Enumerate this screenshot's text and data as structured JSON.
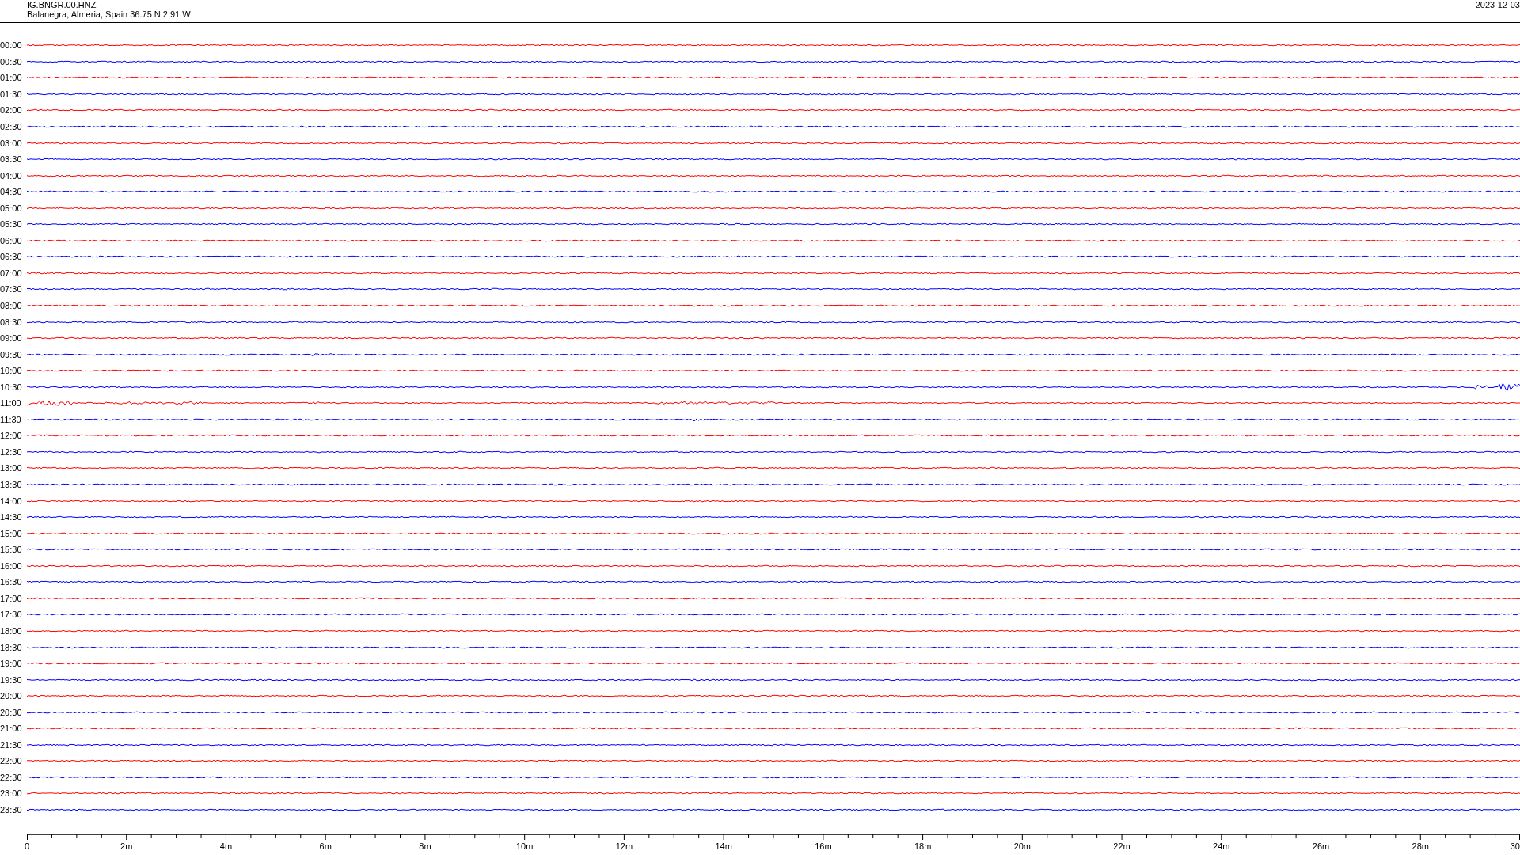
{
  "header": {
    "station": "IG.BNGR.00.HNZ",
    "location": "Balanegra, Almeria, Spain  36.75 N 2.91 W",
    "date": "2023-12-03"
  },
  "rows": [
    {
      "time": "00:00",
      "color": "#ff0000"
    },
    {
      "time": "00:30",
      "color": "#0000ff"
    },
    {
      "time": "01:00",
      "color": "#ff0000"
    },
    {
      "time": "01:30",
      "color": "#0000ff"
    },
    {
      "time": "02:00",
      "color": "#ff0000"
    },
    {
      "time": "02:30",
      "color": "#0000ff"
    },
    {
      "time": "03:00",
      "color": "#ff0000"
    },
    {
      "time": "03:30",
      "color": "#0000ff"
    },
    {
      "time": "04:00",
      "color": "#ff0000"
    },
    {
      "time": "04:30",
      "color": "#0000ff"
    },
    {
      "time": "05:00",
      "color": "#ff0000"
    },
    {
      "time": "05:30",
      "color": "#0000ff"
    },
    {
      "time": "06:00",
      "color": "#ff0000"
    },
    {
      "time": "06:30",
      "color": "#0000ff"
    },
    {
      "time": "07:00",
      "color": "#ff0000"
    },
    {
      "time": "07:30",
      "color": "#0000ff"
    },
    {
      "time": "08:00",
      "color": "#ff0000"
    },
    {
      "time": "08:30",
      "color": "#0000ff"
    },
    {
      "time": "09:00",
      "color": "#ff0000"
    },
    {
      "time": "09:30",
      "color": "#0000ff"
    },
    {
      "time": "10:00",
      "color": "#ff0000"
    },
    {
      "time": "10:30",
      "color": "#0000ff"
    },
    {
      "time": "11:00",
      "color": "#ff0000"
    },
    {
      "time": "11:30",
      "color": "#0000ff"
    },
    {
      "time": "12:00",
      "color": "#ff0000"
    },
    {
      "time": "12:30",
      "color": "#0000ff"
    },
    {
      "time": "13:00",
      "color": "#ff0000"
    },
    {
      "time": "13:30",
      "color": "#0000ff"
    },
    {
      "time": "14:00",
      "color": "#ff0000"
    },
    {
      "time": "14:30",
      "color": "#0000ff"
    },
    {
      "time": "15:00",
      "color": "#ff0000"
    },
    {
      "time": "15:30",
      "color": "#0000ff"
    },
    {
      "time": "16:00",
      "color": "#ff0000"
    },
    {
      "time": "16:30",
      "color": "#0000ff"
    },
    {
      "time": "17:00",
      "color": "#ff0000"
    },
    {
      "time": "17:30",
      "color": "#0000ff"
    },
    {
      "time": "18:00",
      "color": "#ff0000"
    },
    {
      "time": "18:30",
      "color": "#0000ff"
    },
    {
      "time": "19:00",
      "color": "#ff0000"
    },
    {
      "time": "19:30",
      "color": "#0000ff"
    },
    {
      "time": "20:00",
      "color": "#ff0000"
    },
    {
      "time": "20:30",
      "color": "#0000ff"
    },
    {
      "time": "21:00",
      "color": "#ff0000"
    },
    {
      "time": "21:30",
      "color": "#0000ff"
    },
    {
      "time": "22:00",
      "color": "#ff0000"
    },
    {
      "time": "22:30",
      "color": "#0000ff"
    },
    {
      "time": "23:00",
      "color": "#ff0000"
    },
    {
      "time": "23:30",
      "color": "#0000ff"
    }
  ],
  "x_axis": {
    "labels": [
      "0",
      "2m",
      "4m",
      "6m",
      "8m",
      "10m",
      "12m",
      "14m",
      "16m",
      "18m",
      "20m",
      "22m",
      "24m",
      "26m",
      "28m",
      "30"
    ]
  }
}
